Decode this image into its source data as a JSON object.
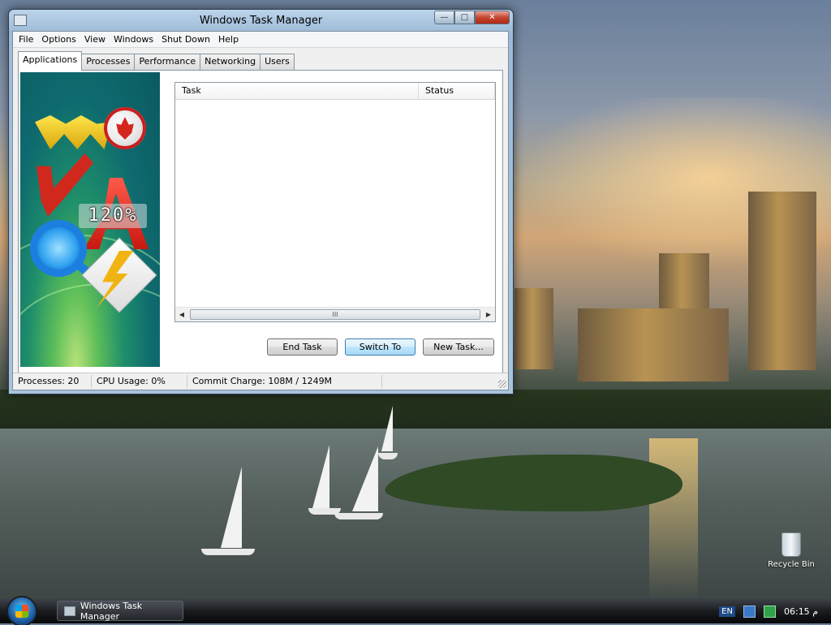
{
  "window": {
    "title": "Windows Task Manager",
    "caption_buttons": {
      "minimize": "—",
      "maximize": "□",
      "close": "✕"
    }
  },
  "menu": [
    "File",
    "Options",
    "View",
    "Windows",
    "Shut Down",
    "Help"
  ],
  "tabs": [
    "Applications",
    "Processes",
    "Performance",
    "Networking",
    "Users"
  ],
  "active_tab": "Applications",
  "art": {
    "badge_text": "120%"
  },
  "task_list": {
    "columns": [
      "Task",
      "Status"
    ],
    "rows": [],
    "scroll_thumb_glyph": "III"
  },
  "buttons": {
    "end_task": "End Task",
    "switch_to": "Switch To",
    "new_task": "New Task..."
  },
  "statusbar": {
    "processes": "Processes: 20",
    "cpu_usage": "CPU Usage: 0%",
    "commit_charge": "Commit Charge: 108M / 1249M"
  },
  "desktop": {
    "recycle_bin_label": "Recycle Bin"
  },
  "taskbar": {
    "task_button_label": "Windows Task Manager",
    "language": "EN",
    "clock": "06:15 م"
  }
}
